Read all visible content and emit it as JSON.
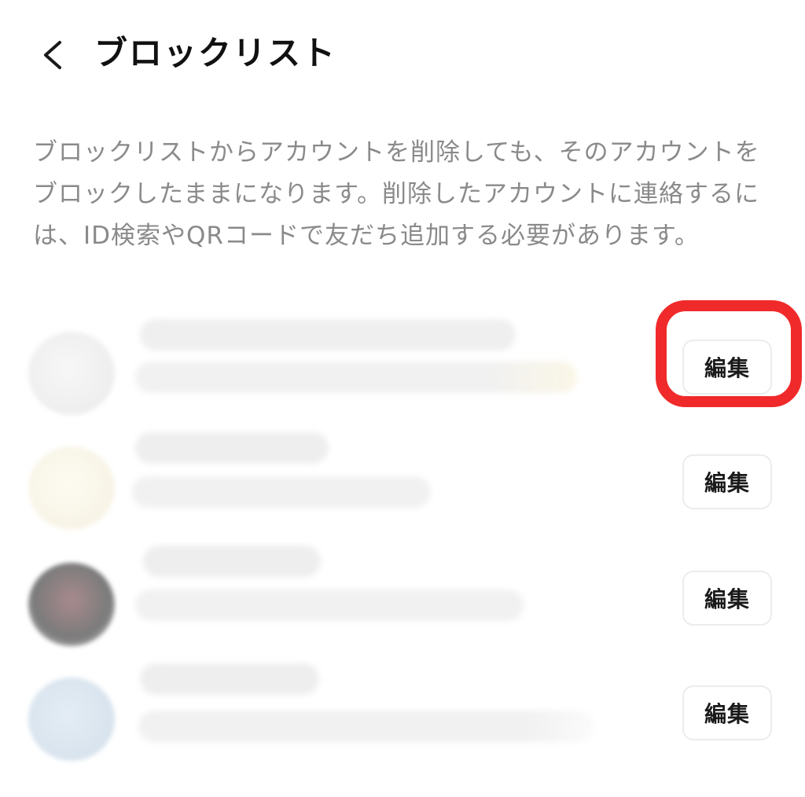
{
  "header": {
    "back_icon": "chevron-left-icon",
    "title": "ブロックリスト"
  },
  "description": {
    "lines": [
      "ブロックリストからアカウントを削除しても、そのアカウントを",
      "ブロックしたままになります。削除したアカウントに連絡するに",
      "は、ID検索やQRコードで友だち追加する必要があります。"
    ]
  },
  "blocked_accounts": [
    {
      "edit_label": "編集",
      "highlighted": true
    },
    {
      "edit_label": "編集",
      "highlighted": false
    },
    {
      "edit_label": "編集",
      "highlighted": false
    },
    {
      "edit_label": "編集",
      "highlighted": false
    }
  ],
  "colors": {
    "highlight": "#f02a2a",
    "description_text": "#8a8a8a"
  }
}
